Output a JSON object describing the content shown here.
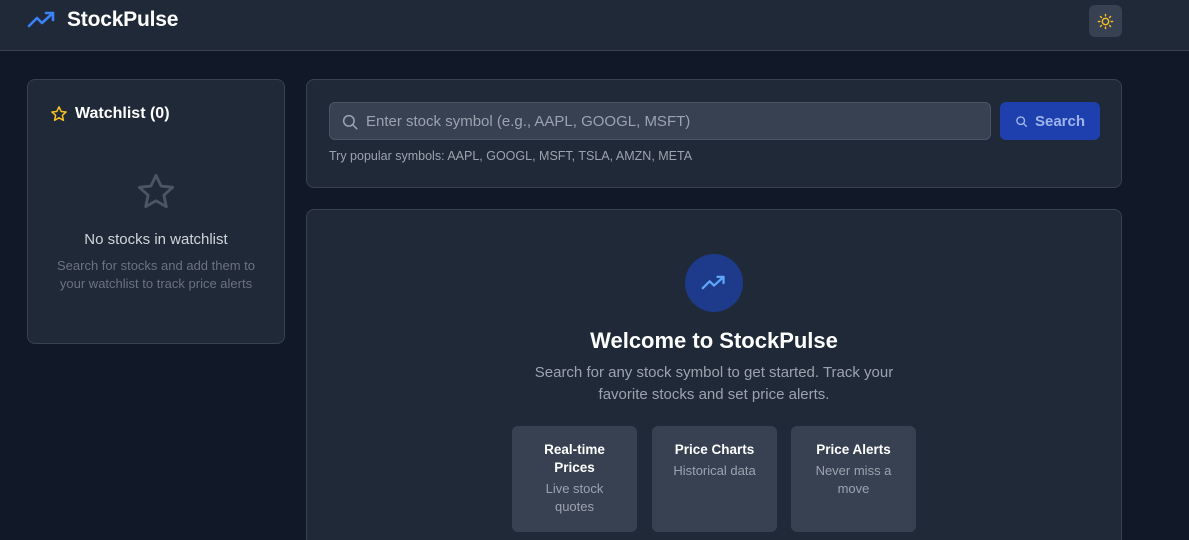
{
  "header": {
    "brand": "StockPulse",
    "logo_icon": "trending-up-icon",
    "theme_toggle_icon": "sun-icon"
  },
  "watchlist": {
    "title": "Watchlist (0)",
    "title_icon": "star-icon",
    "empty_icon": "star-outline-icon",
    "empty_title": "No stocks in watchlist",
    "empty_description": "Search for stocks and add them to your watchlist to track price alerts"
  },
  "search": {
    "placeholder": "Enter stock symbol (e.g., AAPL, GOOGL, MSFT)",
    "value": "",
    "button_label": "Search",
    "hint": "Try popular symbols: AAPL, GOOGL, MSFT, TSLA, AMZN, META"
  },
  "welcome": {
    "icon": "trending-up-icon",
    "title": "Welcome to StockPulse",
    "description": "Search for any stock symbol to get started. Track your favorite stocks and set price alerts.",
    "features": [
      {
        "title": "Real-time Prices",
        "description": "Live stock quotes"
      },
      {
        "title": "Price Charts",
        "description": "Historical data"
      },
      {
        "title": "Price Alerts",
        "description": "Never miss a move"
      }
    ]
  },
  "colors": {
    "background": "#111827",
    "surface": "#1f2937",
    "accent": "#1e40af",
    "star": "#fbbf24"
  }
}
